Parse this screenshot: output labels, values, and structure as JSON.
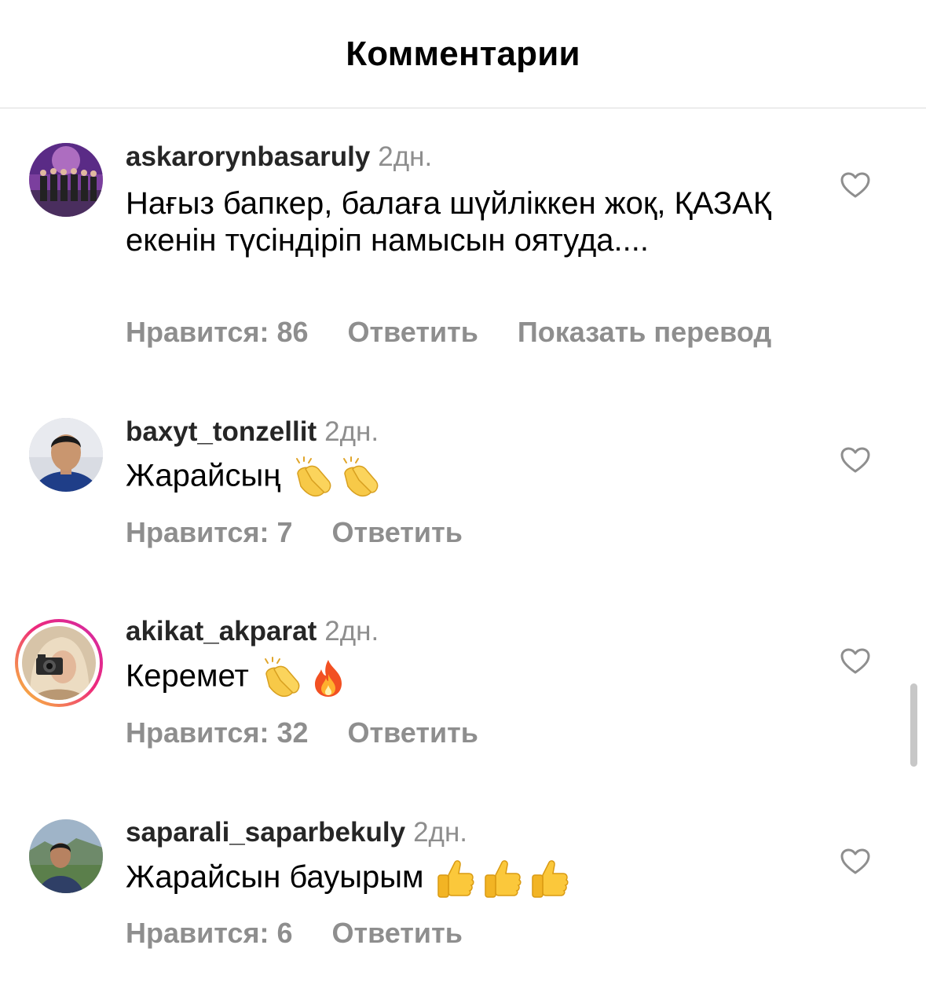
{
  "header": {
    "title": "Комментарии"
  },
  "comments": [
    {
      "username": "askarorynbasaruly",
      "time": "2дн.",
      "text": "Нағыз бапкер, балаға шүйліккен жоқ, ҚАЗАҚ екенін түсіндіріп намысын оятуда....",
      "emojis": [],
      "likes": "Нравится: 86",
      "reply": "Ответить",
      "translate": "Показать перевод"
    },
    {
      "username": "baxyt_tonzellit",
      "time": "2дн.",
      "text": "Жарайсың",
      "emojis": [
        "clapping-hands",
        "clapping-hands"
      ],
      "likes": "Нравится: 7",
      "reply": "Ответить"
    },
    {
      "username": "akikat_akparat",
      "time": "2дн.",
      "text": "Керемет",
      "emojis": [
        "clapping-hands",
        "fire"
      ],
      "likes": "Нравится: 32",
      "reply": "Ответить"
    },
    {
      "username": "saparali_saparbekuly",
      "time": "2дн.",
      "text": "Жарайсын бауырым",
      "emojis": [
        "thumbs-up",
        "thumbs-up",
        "thumbs-up"
      ],
      "likes": "Нравится: 6",
      "reply": "Ответить"
    }
  ]
}
